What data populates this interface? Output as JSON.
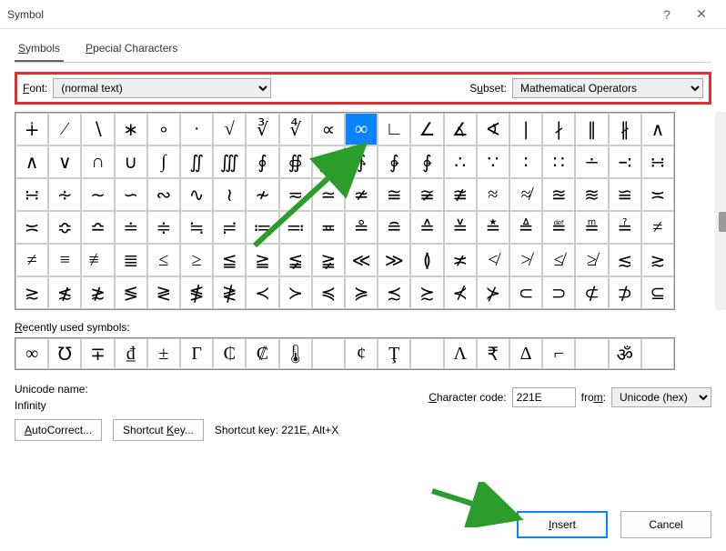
{
  "window": {
    "title": "Symbol",
    "help": "?",
    "close": "✕"
  },
  "tabs": {
    "symbols": "Symbols",
    "special": "Special Characters"
  },
  "font": {
    "label": "Font:",
    "value": "(normal text)",
    "subset_label": "Subset:",
    "subset_value": "Mathematical Operators"
  },
  "grid_rows": [
    [
      "∔",
      "∕",
      "∖",
      "∗",
      "∘",
      "∙",
      "√",
      "∛",
      "∜",
      "∝",
      "∞",
      "∟",
      "∠",
      "∡",
      "∢",
      "∣",
      "∤",
      "∥",
      "∦",
      "∧"
    ],
    [
      "∧",
      "∨",
      "∩",
      "∪",
      "∫",
      "∬",
      "∭",
      "∮",
      "∯",
      "∰",
      "∱",
      "∲",
      "∳",
      "∴",
      "∵",
      "∶",
      "∷",
      "∸",
      "∹",
      "∺"
    ],
    [
      "∺",
      "∻",
      "∼",
      "∽",
      "∾",
      "∿",
      "≀",
      "≁",
      "≂",
      "≃",
      "≄",
      "≅",
      "≆",
      "≇",
      "≈",
      "≉",
      "≊",
      "≋",
      "≌",
      "≍"
    ],
    [
      "≍",
      "≎",
      "≏",
      "≐",
      "≑",
      "≒",
      "≓",
      "≔",
      "≕",
      "≖",
      "≗",
      "≘",
      "≙",
      "≚",
      "≛",
      "≜",
      "≝",
      "≞",
      "≟",
      "≠"
    ],
    [
      "≠",
      "≡",
      "≢",
      "≣",
      "≤",
      "≥",
      "≦",
      "≧",
      "≨",
      "≩",
      "≪",
      "≫",
      "≬",
      "≭",
      "≮",
      "≯",
      "≰",
      "≱",
      "≲",
      "≳"
    ],
    [
      "≳",
      "≴",
      "≵",
      "≶",
      "≷",
      "≸",
      "≹",
      "≺",
      "≻",
      "≼",
      "≽",
      "≾",
      "≿",
      "⊀",
      "⊁",
      "⊂",
      "⊃",
      "⊄",
      "⊅",
      "⊆"
    ]
  ],
  "selected": {
    "row": 0,
    "col": 10
  },
  "recent_label": "Recently used symbols:",
  "recent": [
    "∞",
    "℧",
    "∓",
    "₫",
    "±",
    "Γ",
    "₵",
    "₡",
    "🌡",
    " ",
    "¢",
    "Ţ",
    " ",
    "Λ",
    "₹",
    "Δ",
    "⌐",
    " ",
    "ॐ",
    " "
  ],
  "unicode": {
    "name_label": "Unicode name:",
    "name": "Infinity",
    "code_label": "Character code:",
    "code": "221E",
    "from_label": "from:",
    "from": "Unicode (hex)"
  },
  "buttons": {
    "autocorrect": "AutoCorrect...",
    "shortcut": "Shortcut Key...",
    "shortcut_text": "Shortcut key: 221E, Alt+X",
    "insert": "Insert",
    "cancel": "Cancel"
  }
}
